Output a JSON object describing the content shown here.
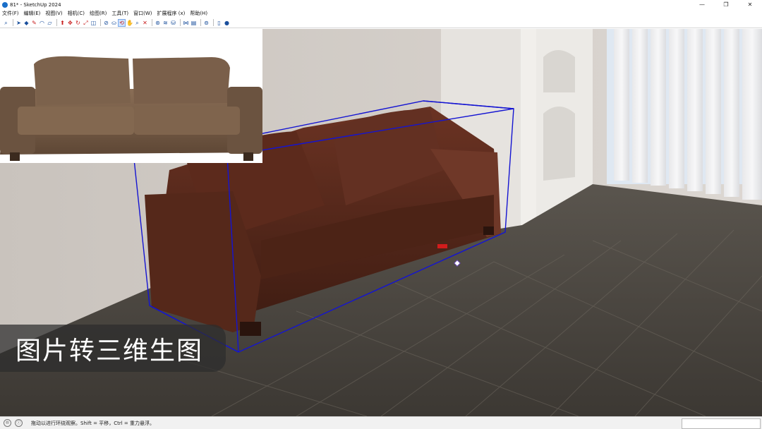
{
  "window": {
    "title": "81* - SketchUp 2024",
    "minimize": "—",
    "maximize": "❐",
    "close": "✕"
  },
  "menu": {
    "items": [
      "文件(F)",
      "编辑(E)",
      "视图(V)",
      "相机(C)",
      "绘图(R)",
      "工具(T)",
      "窗口(W)",
      "扩展程序 (x)",
      "帮助(H)"
    ]
  },
  "toolbar": {
    "icons": [
      "zoom-icon",
      "select-icon",
      "eraser-icon",
      "pencil-icon",
      "arc-icon",
      "rectangle-icon",
      "push-pull-icon",
      "move-icon",
      "rotate-icon",
      "scale-icon",
      "offset-icon",
      "tape-measure-icon",
      "paint-bucket-icon",
      "orbit-icon",
      "pan-icon",
      "zoom-extents-icon",
      "warehouse-icon",
      "extension-icon",
      "account-icon"
    ]
  },
  "caption": {
    "text": "图片转三维生图"
  },
  "status": {
    "hint": "拖动以进行环绕观察。Shift = 平移，Ctrl = 重力悬浮。",
    "geo_icon": "®",
    "info_icon": "ⓘ"
  },
  "colors": {
    "bounding_box": "#1414d2",
    "sofa_leather": "#5a2a1b",
    "floor": "#4a453f",
    "wall": "#cfcac5"
  }
}
